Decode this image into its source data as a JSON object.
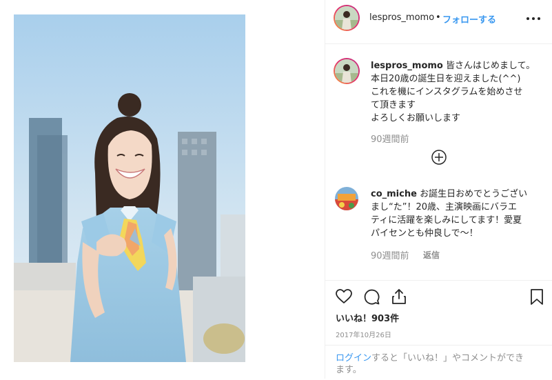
{
  "post": {
    "username": "lespros_momo",
    "separator": "•",
    "follow_label": "フォローする",
    "caption": {
      "username": "lespros_momo",
      "lines": [
        "皆さんはじめまして。",
        "本日20歳の誕生日を迎えました(^^)",
        "これを機にインスタグラムを始めさせ",
        "て頂きます",
        "よろしくお願いします"
      ],
      "time": "90週間前"
    },
    "comments": [
      {
        "username": "co_miche",
        "lines": [
          "お誕生日おめでとうござい",
          "まし“た”！20歳、主演映画にバラエ",
          "ティに活躍を楽しみにしてます！愛夏",
          "パイセンとも仲良しで～！"
        ],
        "time": "90週間前",
        "reply_label": "返信"
      }
    ],
    "likes_label": "いいね！903件",
    "date": "2017年10月26日",
    "login": {
      "link": "ログイン",
      "text_a": "すると「いいね！」やコメントができ",
      "text_b": "ます。"
    }
  },
  "icons": [
    "more-icon",
    "load-more-icon",
    "heart-icon",
    "comment-icon",
    "share-icon",
    "bookmark-icon"
  ],
  "colors": {
    "accent": "#3897f0",
    "muted": "#8e8e8e",
    "text": "#262626",
    "border": "#efefef"
  }
}
